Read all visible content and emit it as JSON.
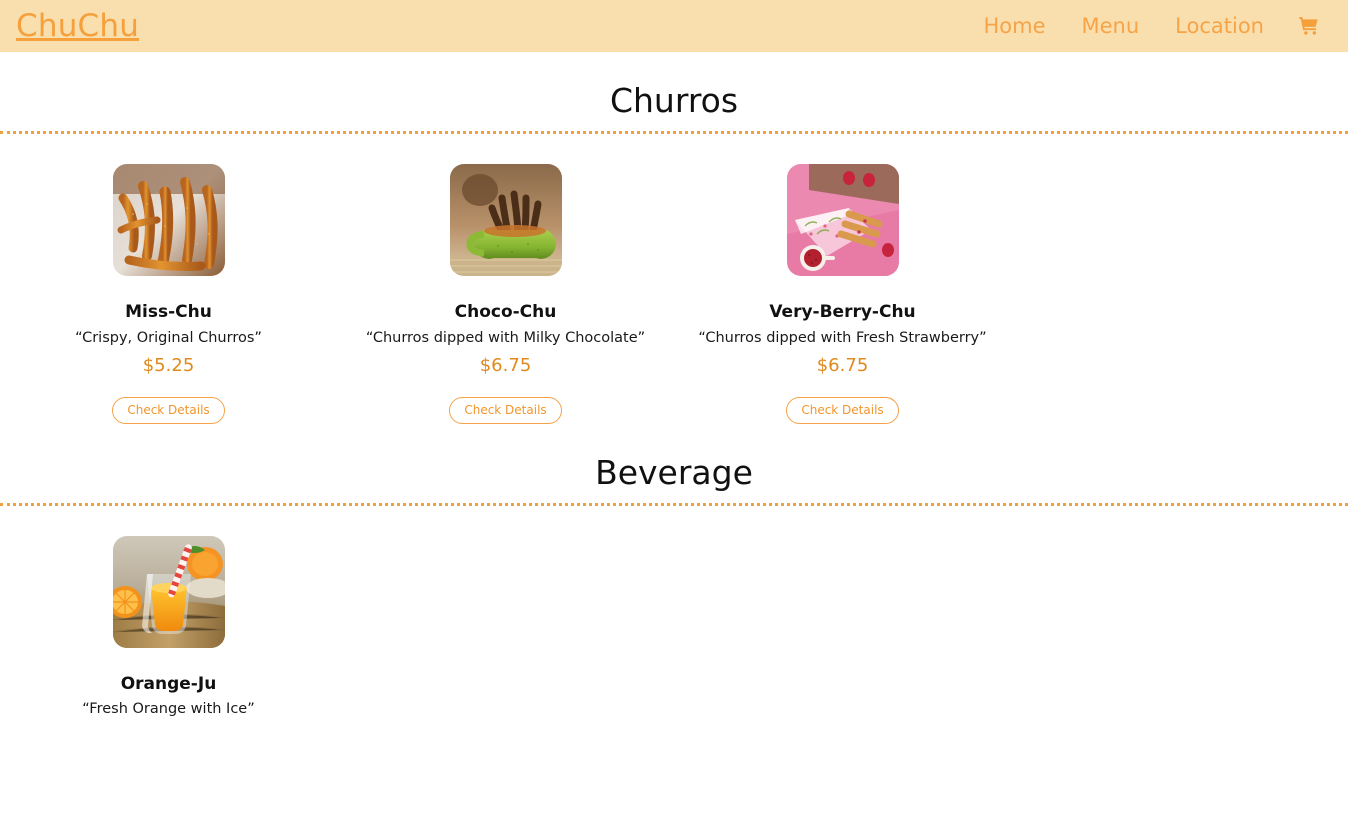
{
  "header": {
    "brand": "ChuChu",
    "nav": [
      {
        "label": "Home",
        "name": "nav-link-home"
      },
      {
        "label": "Menu",
        "name": "nav-link-menu"
      },
      {
        "label": "Location",
        "name": "nav-link-location"
      }
    ],
    "cart_icon": "shopping-cart-icon",
    "background_color": "#fadfae",
    "brand_color": "#f6a03c",
    "link_color": "#f7a346"
  },
  "theme": {
    "accent": "#f0a13e",
    "price_color": "#e08a1e",
    "button_border": "#f5a24a",
    "heading_color": "#111111",
    "page_background": "#ffffff"
  },
  "sections": [
    {
      "title": "Churros",
      "items": [
        {
          "name": "Miss-Chu",
          "description": "“Crispy, Original Churros”",
          "price": "$5.25",
          "button": "Check Details",
          "image": "churros-plain-photo"
        },
        {
          "name": "Choco-Chu",
          "description": "“Churros dipped with Milky Chocolate”",
          "price": "$6.75",
          "button": "Check Details",
          "image": "churros-chocolate-bowl-photo"
        },
        {
          "name": "Very-Berry-Chu",
          "description": "“Churros dipped with Fresh Strawberry”",
          "price": "$6.75",
          "button": "Check Details",
          "image": "churros-strawberry-pink-photo"
        }
      ]
    },
    {
      "title": "Beverage",
      "items": [
        {
          "name": "Orange-Ju",
          "description": "“Fresh Orange with Ice”",
          "price": "",
          "button": "",
          "image": "orange-juice-glass-photo"
        }
      ]
    }
  ]
}
